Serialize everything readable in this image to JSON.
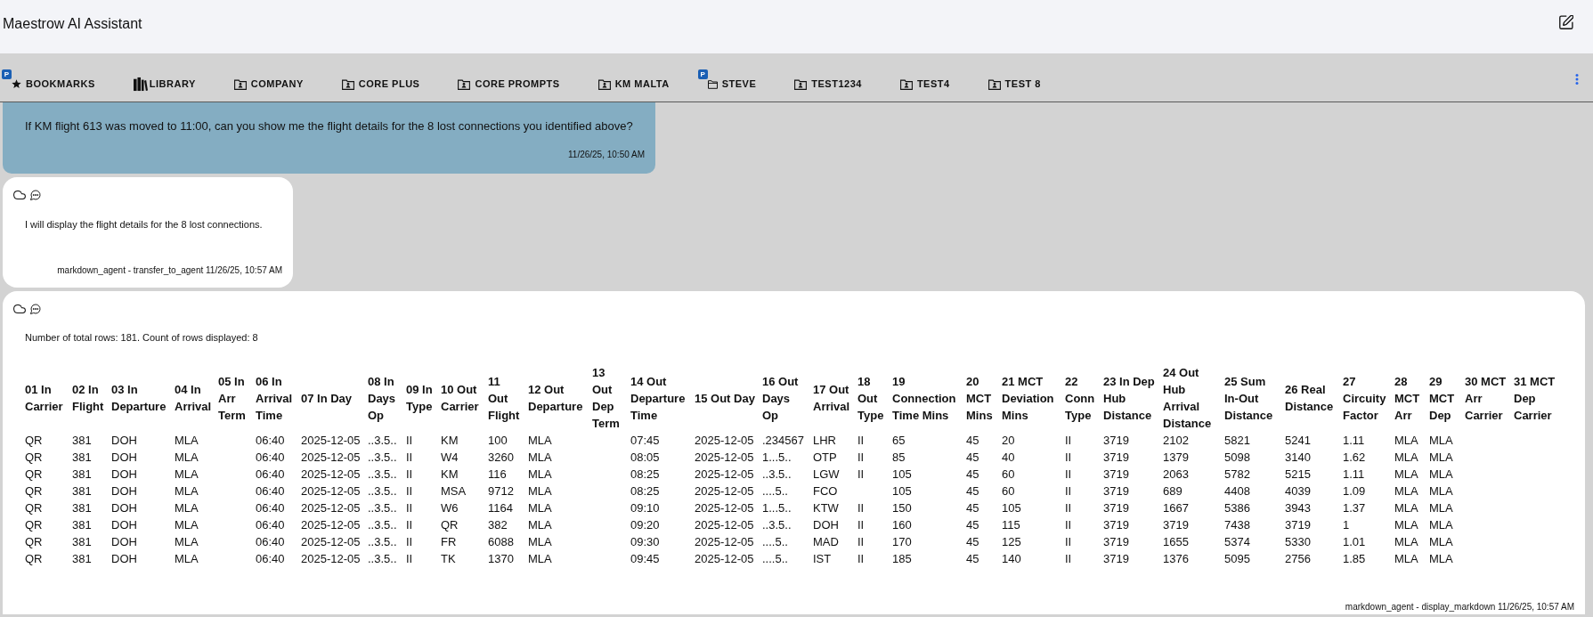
{
  "header": {
    "title": "Maestrow AI Assistant"
  },
  "tabs": [
    {
      "label": "BOOKMARKS",
      "kind": "bookmarks",
      "badge": "P"
    },
    {
      "label": "LIBRARY",
      "kind": "library"
    },
    {
      "label": "COMPANY",
      "kind": "shared"
    },
    {
      "label": "CORE PLUS",
      "kind": "shared"
    },
    {
      "label": "CORE PROMPTS",
      "kind": "shared"
    },
    {
      "label": "KM MALTA",
      "kind": "shared"
    },
    {
      "label": "STEVE",
      "kind": "folder",
      "badge": "P"
    },
    {
      "label": "TEST1234",
      "kind": "shared"
    },
    {
      "label": "TEST4",
      "kind": "shared"
    },
    {
      "label": "TEST 8",
      "kind": "shared"
    }
  ],
  "messages": [
    {
      "kind": "user",
      "text": "If KM flight 613 was moved to 11:00, can you show me the flight details for the 8 lost connections you identified above?",
      "timestamp": "11/26/25, 10:50 AM"
    },
    {
      "kind": "assistant",
      "text": "I will display the flight details for the 8 lost connections.",
      "footer": "markdown_agent - transfer_to_agent 11/26/25, 10:57 AM"
    },
    {
      "kind": "assistant",
      "text": "Number of total rows: 181. Count of rows displayed: 8",
      "table": {
        "columns": [
          "01 In Carrier",
          "02 In Flight",
          "03 In Departure",
          "04 In Arrival",
          "05 In Arr Term",
          "06 In Arrival Time",
          "07 In Day",
          "08 In Days Op",
          "09 In Type",
          "10 Out Carrier",
          "11 Out Flight",
          "12 Out Departure",
          "13 Out Dep Term",
          "14 Out Departure Time",
          "15 Out Day",
          "16 Out Days Op",
          "17 Out Arrival",
          "18 Out Type",
          "19 Connection Time Mins",
          "20 MCT Mins",
          "21 MCT Deviation Mins",
          "22 Conn Type",
          "23 In Dep Hub Distance",
          "24 Out Hub Arrival Distance",
          "25 Sum In-Out Distance",
          "26 Real Distance",
          "27 Circuity Factor",
          "28 MCT Arr",
          "29 MCT Dep",
          "30 MCT Arr Carrier",
          "31 MCT Dep Carrier"
        ],
        "rows": [
          [
            "QR",
            "381",
            "DOH",
            "MLA",
            null,
            "06:40",
            "2025-12-05",
            "..3.5..",
            "II",
            "KM",
            "100",
            "MLA",
            null,
            "07:45",
            "2025-12-05",
            ".234567",
            "LHR",
            "II",
            "65",
            "45",
            "20",
            "II",
            "3719",
            "2102",
            "5821",
            "5241",
            "1.11",
            "MLA",
            "MLA",
            null,
            null
          ],
          [
            "QR",
            "381",
            "DOH",
            "MLA",
            null,
            "06:40",
            "2025-12-05",
            "..3.5..",
            "II",
            "W4",
            "3260",
            "MLA",
            null,
            "08:05",
            "2025-12-05",
            "1...5..",
            "OTP",
            "II",
            "85",
            "45",
            "40",
            "II",
            "3719",
            "1379",
            "5098",
            "3140",
            "1.62",
            "MLA",
            "MLA",
            null,
            null
          ],
          [
            "QR",
            "381",
            "DOH",
            "MLA",
            null,
            "06:40",
            "2025-12-05",
            "..3.5..",
            "II",
            "KM",
            "116",
            "MLA",
            null,
            "08:25",
            "2025-12-05",
            "..3.5..",
            "LGW",
            "II",
            "105",
            "45",
            "60",
            "II",
            "3719",
            "2063",
            "5782",
            "5215",
            "1.11",
            "MLA",
            "MLA",
            null,
            null
          ],
          [
            "QR",
            "381",
            "DOH",
            "MLA",
            null,
            "06:40",
            "2025-12-05",
            "..3.5..",
            "II",
            "MSA",
            "9712",
            "MLA",
            null,
            "08:25",
            "2025-12-05",
            "....5..",
            "FCO",
            null,
            "105",
            "45",
            "60",
            "II",
            "3719",
            "689",
            "4408",
            "4039",
            "1.09",
            "MLA",
            "MLA",
            null,
            null
          ],
          [
            "QR",
            "381",
            "DOH",
            "MLA",
            null,
            "06:40",
            "2025-12-05",
            "..3.5..",
            "II",
            "W6",
            "1164",
            "MLA",
            null,
            "09:10",
            "2025-12-05",
            "1...5..",
            "KTW",
            "II",
            "150",
            "45",
            "105",
            "II",
            "3719",
            "1667",
            "5386",
            "3943",
            "1.37",
            "MLA",
            "MLA",
            null,
            null
          ],
          [
            "QR",
            "381",
            "DOH",
            "MLA",
            null,
            "06:40",
            "2025-12-05",
            "..3.5..",
            "II",
            "QR",
            "382",
            "MLA",
            null,
            "09:20",
            "2025-12-05",
            "..3.5..",
            "DOH",
            "II",
            "160",
            "45",
            "115",
            "II",
            "3719",
            "3719",
            "7438",
            "3719",
            "1",
            "MLA",
            "MLA",
            null,
            null
          ],
          [
            "QR",
            "381",
            "DOH",
            "MLA",
            null,
            "06:40",
            "2025-12-05",
            "..3.5..",
            "II",
            "FR",
            "6088",
            "MLA",
            null,
            "09:30",
            "2025-12-05",
            "....5..",
            "MAD",
            "II",
            "170",
            "45",
            "125",
            "II",
            "3719",
            "1655",
            "5374",
            "5330",
            "1.01",
            "MLA",
            "MLA",
            null,
            null
          ],
          [
            "QR",
            "381",
            "DOH",
            "MLA",
            null,
            "06:40",
            "2025-12-05",
            "..3.5..",
            "II",
            "TK",
            "1370",
            "MLA",
            null,
            "09:45",
            "2025-12-05",
            "....5..",
            "IST",
            "II",
            "185",
            "45",
            "140",
            "II",
            "3719",
            "1376",
            "5095",
            "2756",
            "1.85",
            "MLA",
            "MLA",
            null,
            null
          ]
        ]
      },
      "footer": "markdown_agent - display_markdown 11/26/25, 10:57 AM"
    }
  ]
}
